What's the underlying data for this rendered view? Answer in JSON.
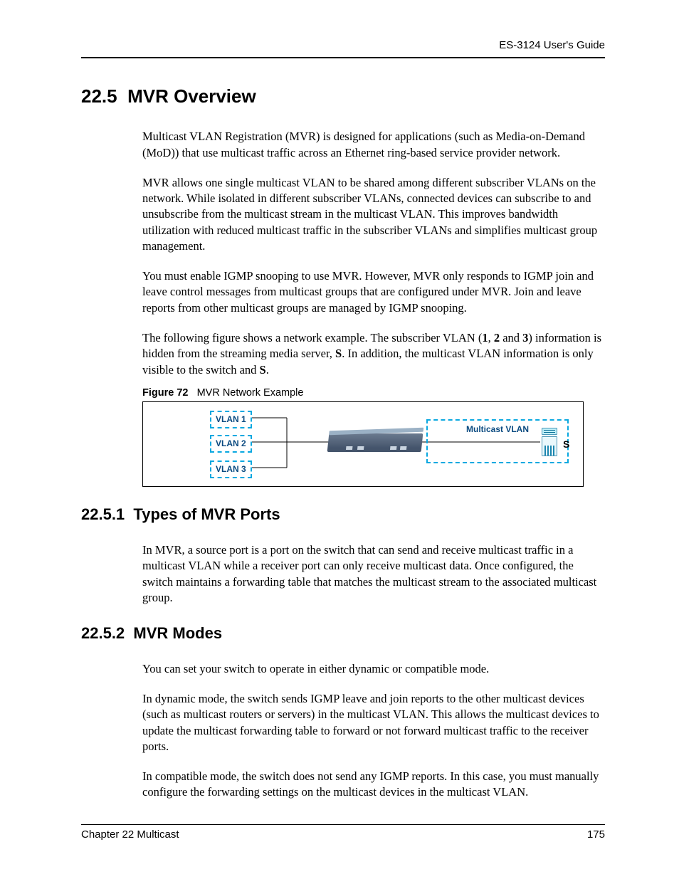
{
  "header": {
    "guide_title": "ES-3124 User's Guide"
  },
  "section": {
    "number": "22.5",
    "title": "MVR Overview"
  },
  "paragraphs": {
    "p1": "Multicast VLAN Registration (MVR) is designed for applications (such as Media-on-Demand (MoD)) that use multicast traffic across an Ethernet ring-based service provider network.",
    "p2": "MVR allows one single multicast VLAN to be shared among different subscriber VLANs on the network. While isolated in different subscriber VLANs, connected devices can subscribe to and unsubscribe from the multicast stream in the multicast VLAN. This improves bandwidth utilization with reduced multicast traffic in the subscriber VLANs and simplifies multicast group management.",
    "p3": "You must enable IGMP snooping to use MVR. However, MVR only responds to IGMP join and leave control messages from multicast groups that are configured under MVR. Join and leave reports from other multicast groups are managed by IGMP snooping.",
    "p4_pre": "The following figure shows a network example. The subscriber VLAN (",
    "p4_b1": "1",
    "p4_mid1": ", ",
    "p4_b2": "2",
    "p4_mid2": " and ",
    "p4_b3": "3",
    "p4_mid3": ") information is hidden from the streaming media server, ",
    "p4_bS1": "S",
    "p4_mid4": ". In addition, the multicast VLAN information is only visible to the switch and ",
    "p4_bS2": "S",
    "p4_post": "."
  },
  "figure": {
    "label": "Figure 72",
    "caption": "MVR Network Example",
    "vlan1": "VLAN 1",
    "vlan2": "VLAN 2",
    "vlan3": "VLAN 3",
    "multicast_vlan": "Multicast VLAN",
    "server_label": "S"
  },
  "subsection1": {
    "number": "22.5.1",
    "title": "Types of MVR Ports",
    "p1": "In MVR, a source port is a port on the switch that can send and receive multicast traffic in a multicast VLAN while a receiver port can only receive multicast data. Once configured, the switch maintains a forwarding table that matches the multicast stream to the associated multicast group."
  },
  "subsection2": {
    "number": "22.5.2",
    "title": "MVR Modes",
    "p1": "You can set your switch to operate in either dynamic or compatible mode.",
    "p2": "In dynamic mode, the switch sends IGMP leave and join reports to the other multicast devices (such as multicast routers or servers) in the multicast VLAN. This allows the multicast devices to update the multicast forwarding table to forward or not forward multicast traffic to the receiver ports.",
    "p3": "In compatible mode, the switch does not send any IGMP reports. In this case, you must manually configure the forwarding settings on the multicast devices in the multicast VLAN."
  },
  "footer": {
    "chapter": "Chapter 22 Multicast",
    "page": "175"
  }
}
